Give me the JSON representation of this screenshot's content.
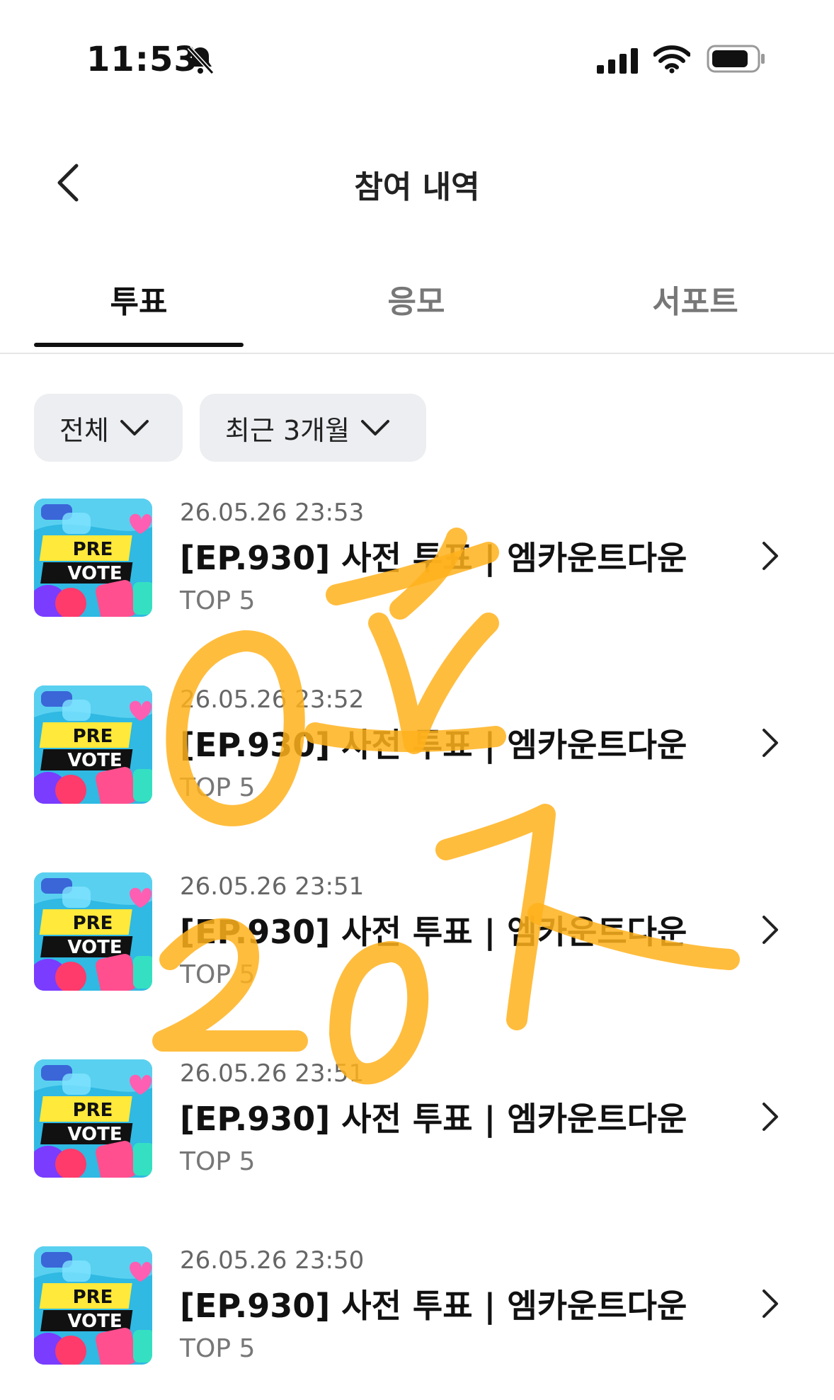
{
  "status_bar": {
    "time": "11:53"
  },
  "header": {
    "title": "참여 내역"
  },
  "tabs": [
    {
      "label": "투표",
      "active": true
    },
    {
      "label": "응모",
      "active": false
    },
    {
      "label": "서포트",
      "active": false
    }
  ],
  "filters": [
    {
      "label": "전체"
    },
    {
      "label": "최근 3개월"
    }
  ],
  "thumbnail": {
    "line1": "PRE",
    "line2": "VOTE"
  },
  "items": [
    {
      "date": "26.05.26 23:53",
      "title": "[EP.930] 사전 투표 | 엠카운트다운",
      "subtitle": "TOP 5"
    },
    {
      "date": "26.05.26 23:52",
      "title": "[EP.930] 사전 투표 | 엠카운트다운",
      "subtitle": "TOP 5"
    },
    {
      "date": "26.05.26 23:51",
      "title": "[EP.930] 사전 투표 | 엠카운트다운",
      "subtitle": "TOP 5"
    },
    {
      "date": "26.05.26 23:51",
      "title": "[EP.930] 사전 투표 | 엠카운트다운",
      "subtitle": "TOP 5"
    },
    {
      "date": "26.05.26 23:50",
      "title": "[EP.930] 사전 투표 | 엠카운트다운",
      "subtitle": "TOP 5"
    }
  ],
  "colors": {
    "scribble": "#ffb21c",
    "thumb_bg": "#2fb9e3",
    "thumb_label_bg": "#ffe93b"
  }
}
